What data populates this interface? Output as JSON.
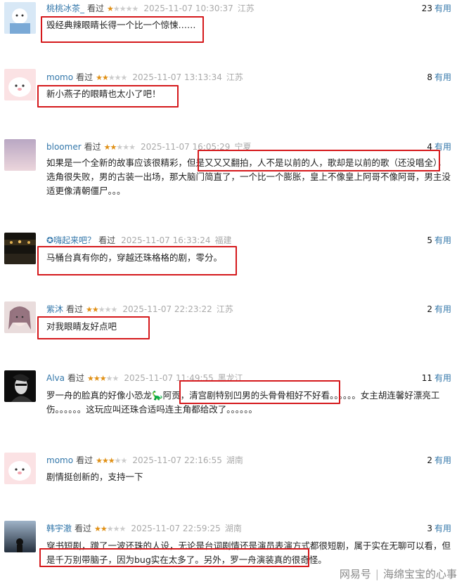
{
  "reviews": [
    {
      "username": "桃桃冰茶_",
      "status": "看过",
      "stars_filled": 1,
      "stars_total": 5,
      "time": "2025-11-07 10:30:37",
      "location": "江苏",
      "useful_count": "23",
      "useful_label": "有用",
      "content": "毁经典辣眼睛长得一个比一个惊悚……",
      "avatar_colors": [
        "#cfe3f5",
        "#ffffff"
      ]
    },
    {
      "username": "momo",
      "status": "看过",
      "stars_filled": 2,
      "stars_total": 5,
      "time": "2025-11-07 13:13:34",
      "location": "江苏",
      "useful_count": "8",
      "useful_label": "有用",
      "content": "新小燕子的眼睛也太小了吧！",
      "avatar_colors": [
        "#fbe2e4",
        "#ffffff"
      ]
    },
    {
      "username": "bloomer",
      "status": "看过",
      "stars_filled": 2,
      "stars_total": 5,
      "time": "2025-11-07 16:05:29",
      "location": "宁夏",
      "useful_count": "4",
      "useful_label": "有用",
      "content": "如果是一个全新的故事应该很精彩，但是又又又翻拍，人不是以前的人，歌却是以前的歌（还没唱全），选角很失败，男的古装一出场，那大脑门简直了，一个比一个膨胀，皇上不像皇上阿哥不像阿哥，男主没适更像清朝僵尸。。。",
      "avatar_colors": [
        "#c9b6c8",
        "#e8d6df"
      ]
    },
    {
      "username": "✪嗨起来吧？",
      "status": "看过",
      "stars_filled": 0,
      "stars_total": 0,
      "time": "2025-11-07 16:33:24",
      "location": "福建",
      "useful_count": "5",
      "useful_label": "有用",
      "content": "马桶台真有你的，穿越还珠格格的剧，零分。",
      "avatar_colors": [
        "#1c1a16",
        "#d9a640"
      ]
    },
    {
      "username": "紫沐",
      "status": "看过",
      "stars_filled": 2,
      "stars_total": 5,
      "time": "2025-11-07 22:23:22",
      "location": "江苏",
      "useful_count": "2",
      "useful_label": "有用",
      "content": "对我眼睛友好点吧",
      "avatar_colors": [
        "#e7d7d9",
        "#8b5e6a"
      ]
    },
    {
      "username": "Alva",
      "status": "看过",
      "stars_filled": 3,
      "stars_total": 5,
      "time": "2025-11-07 11:49:55",
      "location": "黑龙江",
      "useful_count": "11",
      "useful_label": "有用",
      "content": "罗一舟的脸真的好像小恐龙🦕阿贡，清宫剧特别凹男的头骨骨相好不好看。。。。。。女主胡连馨好漂亮工伤。。。。。。这玩应叫还珠合适吗连主角都给改了。。。。。。",
      "avatar_colors": [
        "#111111",
        "#dddddd"
      ]
    },
    {
      "username": "momo",
      "status": "看过",
      "stars_filled": 3,
      "stars_total": 5,
      "time": "2025-11-07 22:16:55",
      "location": "湖南",
      "useful_count": "2",
      "useful_label": "有用",
      "content": "剧情挺创新的，支持一下",
      "avatar_colors": [
        "#fbe2e4",
        "#ffffff"
      ]
    },
    {
      "username": "韩宇澈",
      "status": "看过",
      "stars_filled": 2,
      "stars_total": 5,
      "time": "2025-11-07 22:59:25",
      "location": "湖南",
      "useful_count": "3",
      "useful_label": "有用",
      "content": "穿书短剧，蹭了一波还珠的人设，无论是台词剧情还是演员表演方式都很短剧，属于实在无聊可以看，但是千万别带脑子，因为bug实在太多了。另外，罗一舟演装真的很奇怪。",
      "avatar_colors": [
        "#2d3a4c",
        "#9fb3c8"
      ]
    }
  ],
  "footer": {
    "brand": "网易号",
    "author": "海绵宝宝的心事"
  },
  "colors": {
    "highlight": "#d5191c",
    "star_on": "#e09015",
    "star_off": "#cccccc",
    "username": "#3377aa"
  }
}
